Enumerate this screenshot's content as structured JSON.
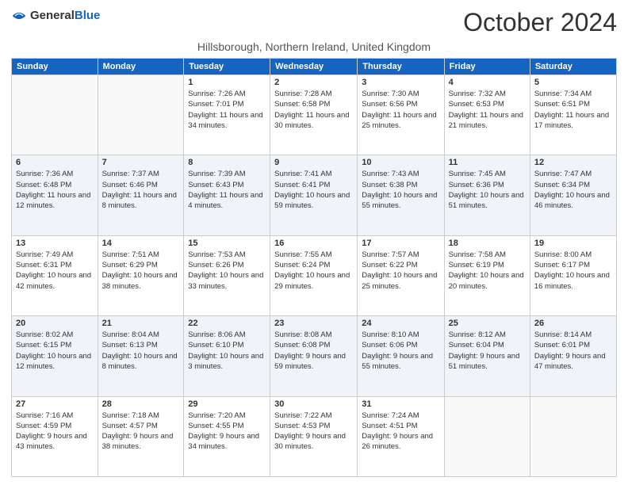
{
  "header": {
    "logo_general": "General",
    "logo_blue": "Blue",
    "month_title": "October 2024",
    "subtitle": "Hillsborough, Northern Ireland, United Kingdom"
  },
  "weekdays": [
    "Sunday",
    "Monday",
    "Tuesday",
    "Wednesday",
    "Thursday",
    "Friday",
    "Saturday"
  ],
  "weeks": [
    [
      {
        "day": "",
        "sunrise": "",
        "sunset": "",
        "daylight": ""
      },
      {
        "day": "",
        "sunrise": "",
        "sunset": "",
        "daylight": ""
      },
      {
        "day": "1",
        "sunrise": "Sunrise: 7:26 AM",
        "sunset": "Sunset: 7:01 PM",
        "daylight": "Daylight: 11 hours and 34 minutes."
      },
      {
        "day": "2",
        "sunrise": "Sunrise: 7:28 AM",
        "sunset": "Sunset: 6:58 PM",
        "daylight": "Daylight: 11 hours and 30 minutes."
      },
      {
        "day": "3",
        "sunrise": "Sunrise: 7:30 AM",
        "sunset": "Sunset: 6:56 PM",
        "daylight": "Daylight: 11 hours and 25 minutes."
      },
      {
        "day": "4",
        "sunrise": "Sunrise: 7:32 AM",
        "sunset": "Sunset: 6:53 PM",
        "daylight": "Daylight: 11 hours and 21 minutes."
      },
      {
        "day": "5",
        "sunrise": "Sunrise: 7:34 AM",
        "sunset": "Sunset: 6:51 PM",
        "daylight": "Daylight: 11 hours and 17 minutes."
      }
    ],
    [
      {
        "day": "6",
        "sunrise": "Sunrise: 7:36 AM",
        "sunset": "Sunset: 6:48 PM",
        "daylight": "Daylight: 11 hours and 12 minutes."
      },
      {
        "day": "7",
        "sunrise": "Sunrise: 7:37 AM",
        "sunset": "Sunset: 6:46 PM",
        "daylight": "Daylight: 11 hours and 8 minutes."
      },
      {
        "day": "8",
        "sunrise": "Sunrise: 7:39 AM",
        "sunset": "Sunset: 6:43 PM",
        "daylight": "Daylight: 11 hours and 4 minutes."
      },
      {
        "day": "9",
        "sunrise": "Sunrise: 7:41 AM",
        "sunset": "Sunset: 6:41 PM",
        "daylight": "Daylight: 10 hours and 59 minutes."
      },
      {
        "day": "10",
        "sunrise": "Sunrise: 7:43 AM",
        "sunset": "Sunset: 6:38 PM",
        "daylight": "Daylight: 10 hours and 55 minutes."
      },
      {
        "day": "11",
        "sunrise": "Sunrise: 7:45 AM",
        "sunset": "Sunset: 6:36 PM",
        "daylight": "Daylight: 10 hours and 51 minutes."
      },
      {
        "day": "12",
        "sunrise": "Sunrise: 7:47 AM",
        "sunset": "Sunset: 6:34 PM",
        "daylight": "Daylight: 10 hours and 46 minutes."
      }
    ],
    [
      {
        "day": "13",
        "sunrise": "Sunrise: 7:49 AM",
        "sunset": "Sunset: 6:31 PM",
        "daylight": "Daylight: 10 hours and 42 minutes."
      },
      {
        "day": "14",
        "sunrise": "Sunrise: 7:51 AM",
        "sunset": "Sunset: 6:29 PM",
        "daylight": "Daylight: 10 hours and 38 minutes."
      },
      {
        "day": "15",
        "sunrise": "Sunrise: 7:53 AM",
        "sunset": "Sunset: 6:26 PM",
        "daylight": "Daylight: 10 hours and 33 minutes."
      },
      {
        "day": "16",
        "sunrise": "Sunrise: 7:55 AM",
        "sunset": "Sunset: 6:24 PM",
        "daylight": "Daylight: 10 hours and 29 minutes."
      },
      {
        "day": "17",
        "sunrise": "Sunrise: 7:57 AM",
        "sunset": "Sunset: 6:22 PM",
        "daylight": "Daylight: 10 hours and 25 minutes."
      },
      {
        "day": "18",
        "sunrise": "Sunrise: 7:58 AM",
        "sunset": "Sunset: 6:19 PM",
        "daylight": "Daylight: 10 hours and 20 minutes."
      },
      {
        "day": "19",
        "sunrise": "Sunrise: 8:00 AM",
        "sunset": "Sunset: 6:17 PM",
        "daylight": "Daylight: 10 hours and 16 minutes."
      }
    ],
    [
      {
        "day": "20",
        "sunrise": "Sunrise: 8:02 AM",
        "sunset": "Sunset: 6:15 PM",
        "daylight": "Daylight: 10 hours and 12 minutes."
      },
      {
        "day": "21",
        "sunrise": "Sunrise: 8:04 AM",
        "sunset": "Sunset: 6:13 PM",
        "daylight": "Daylight: 10 hours and 8 minutes."
      },
      {
        "day": "22",
        "sunrise": "Sunrise: 8:06 AM",
        "sunset": "Sunset: 6:10 PM",
        "daylight": "Daylight: 10 hours and 3 minutes."
      },
      {
        "day": "23",
        "sunrise": "Sunrise: 8:08 AM",
        "sunset": "Sunset: 6:08 PM",
        "daylight": "Daylight: 9 hours and 59 minutes."
      },
      {
        "day": "24",
        "sunrise": "Sunrise: 8:10 AM",
        "sunset": "Sunset: 6:06 PM",
        "daylight": "Daylight: 9 hours and 55 minutes."
      },
      {
        "day": "25",
        "sunrise": "Sunrise: 8:12 AM",
        "sunset": "Sunset: 6:04 PM",
        "daylight": "Daylight: 9 hours and 51 minutes."
      },
      {
        "day": "26",
        "sunrise": "Sunrise: 8:14 AM",
        "sunset": "Sunset: 6:01 PM",
        "daylight": "Daylight: 9 hours and 47 minutes."
      }
    ],
    [
      {
        "day": "27",
        "sunrise": "Sunrise: 7:16 AM",
        "sunset": "Sunset: 4:59 PM",
        "daylight": "Daylight: 9 hours and 43 minutes."
      },
      {
        "day": "28",
        "sunrise": "Sunrise: 7:18 AM",
        "sunset": "Sunset: 4:57 PM",
        "daylight": "Daylight: 9 hours and 38 minutes."
      },
      {
        "day": "29",
        "sunrise": "Sunrise: 7:20 AM",
        "sunset": "Sunset: 4:55 PM",
        "daylight": "Daylight: 9 hours and 34 minutes."
      },
      {
        "day": "30",
        "sunrise": "Sunrise: 7:22 AM",
        "sunset": "Sunset: 4:53 PM",
        "daylight": "Daylight: 9 hours and 30 minutes."
      },
      {
        "day": "31",
        "sunrise": "Sunrise: 7:24 AM",
        "sunset": "Sunset: 4:51 PM",
        "daylight": "Daylight: 9 hours and 26 minutes."
      },
      {
        "day": "",
        "sunrise": "",
        "sunset": "",
        "daylight": ""
      },
      {
        "day": "",
        "sunrise": "",
        "sunset": "",
        "daylight": ""
      }
    ]
  ]
}
